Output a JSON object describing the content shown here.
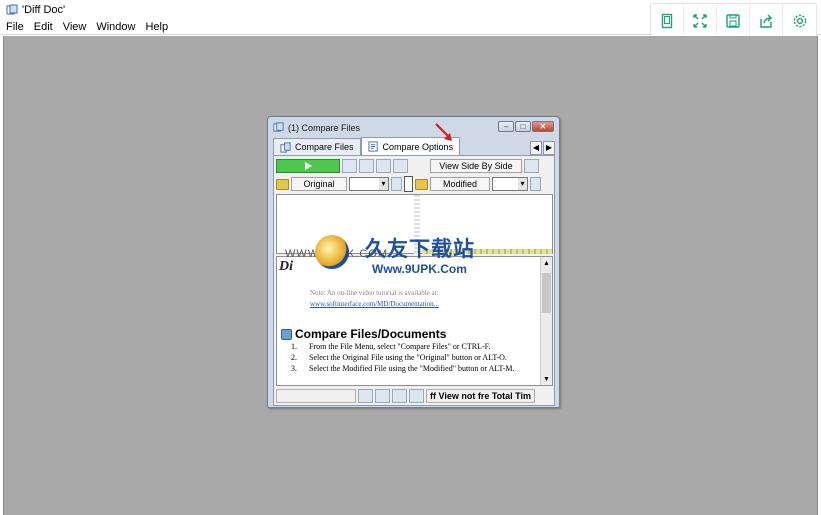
{
  "app": {
    "title": "'Diff Doc'"
  },
  "menu": [
    "File",
    "Edit",
    "View",
    "Window",
    "Help"
  ],
  "side_toolbar": [
    "portrait-icon",
    "fullscreen-icon",
    "save-icon",
    "share-icon",
    "settings-icon"
  ],
  "child_window": {
    "title": "(1) Compare Files",
    "tabs": [
      {
        "label": "Compare Files",
        "active": false
      },
      {
        "label": "Compare Options",
        "active": true
      }
    ],
    "toolbar": {
      "side_by_side": "View Side By Side"
    },
    "file_row": {
      "original": "Original",
      "modified": "Modified"
    },
    "document": {
      "heading": "Di",
      "note": "Note: An on-line video tutorial is available at:",
      "link": "www.softinterface.com/MD/Documentation...",
      "section_title": "Compare Files/Documents",
      "steps": [
        {
          "num": "1.",
          "text": "From the File Menu, select \"Compare Files\" or CTRL-F."
        },
        {
          "num": "2.",
          "text": "Select the Original File using the \"Original\" button or ALT-O."
        },
        {
          "num": "3.",
          "text": "Select the Modified File using the \"Modified\" button or ALT-M."
        }
      ]
    },
    "status": {
      "text": "ff View not fre Total Tim"
    }
  },
  "watermark": {
    "cn": "久友下载站",
    "url": "Www.9UPK.Com",
    "small": "WWW.9UPK.COM"
  },
  "colors": {
    "workspace": "#a9a9a9",
    "go_green": "#4ec74e",
    "accent_teal": "#1aa37a"
  }
}
